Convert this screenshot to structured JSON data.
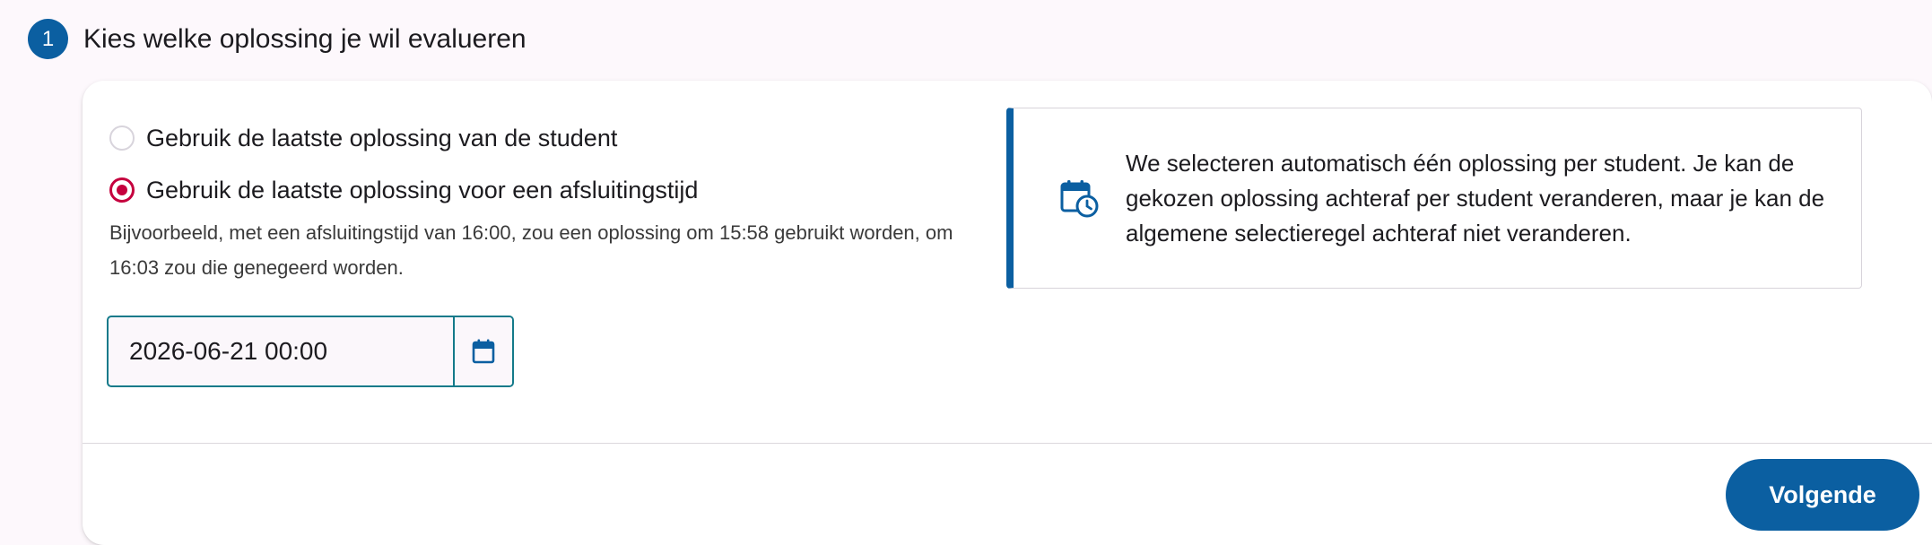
{
  "step": {
    "number": "1",
    "title": "Kies welke oplossing je wil evalueren"
  },
  "options": {
    "latest": {
      "label": "Gebruik de laatste oplossing van de student",
      "selected": false
    },
    "deadline": {
      "label": "Gebruik de laatste oplossing voor een afsluitingstijd",
      "selected": true
    },
    "hint": "Bijvoorbeeld, met een afsluitingstijd van 16:00, zou een oplossing om 15:58 gebruikt worden, om 16:03 zou die genegeerd worden."
  },
  "deadline_input": {
    "value": "2026-06-21 00:00",
    "button_icon": "calendar-icon"
  },
  "info": {
    "icon": "calendar-clock-icon",
    "text": "We selecteren automatisch één oplossing per student. Je kan de gekozen oplossing achteraf per student veranderen, maar je kan de algemene selectieregel achteraf niet veranderen."
  },
  "footer": {
    "next_label": "Volgende"
  },
  "colors": {
    "primary": "#0b5fa1",
    "radio_selected": "#c5003e",
    "input_border": "#137a8a",
    "background": "#fdf8fc"
  }
}
